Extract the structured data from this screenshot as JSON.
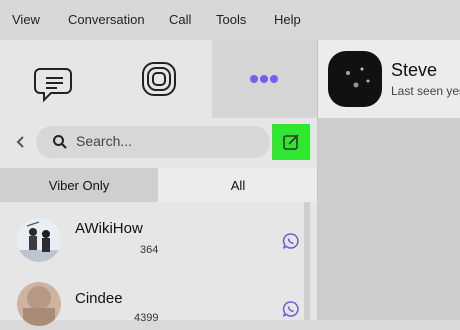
{
  "menu": [
    "View",
    "Conversation",
    "Call",
    "Tools",
    "Help"
  ],
  "toolbar": {
    "chat_icon": "chat-bubble-icon",
    "stories_icon": "stories-icon",
    "more_icon": "more-dots-icon"
  },
  "search": {
    "back_icon": "chevron-left-icon",
    "placeholder": "Search...",
    "compose_icon": "compose-icon"
  },
  "tabs": {
    "viber_only": "Viber Only",
    "all": "All"
  },
  "chats": [
    {
      "name": "AWikiHow",
      "subtitle": "364"
    },
    {
      "name": "Cindee",
      "subtitle": "4399"
    }
  ],
  "conversation": {
    "contact_name": "Steve",
    "status": "Last seen yes"
  },
  "colors": {
    "accent": "#2fe72f",
    "viber_purple": "#7360f2"
  }
}
